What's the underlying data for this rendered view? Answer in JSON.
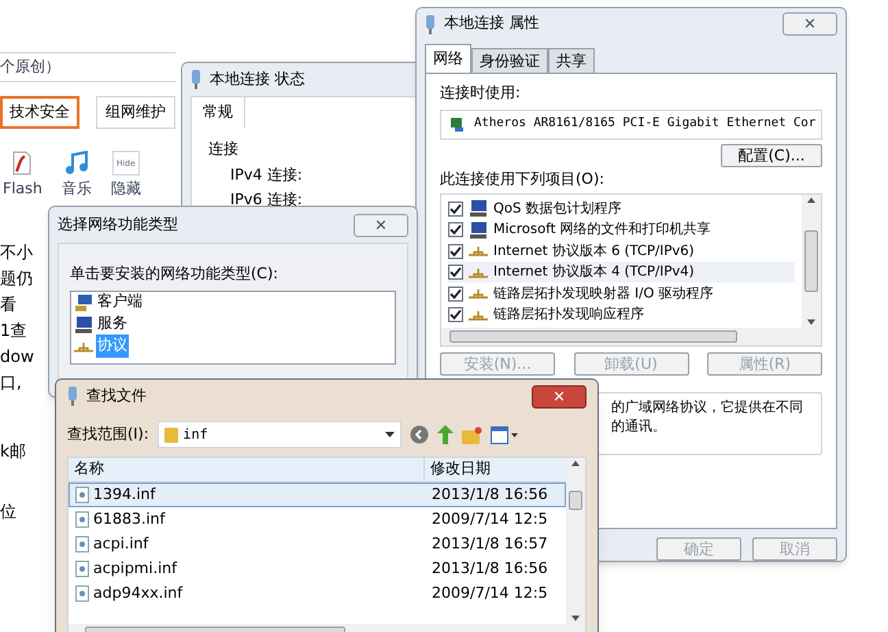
{
  "background_page": {
    "breadcrumb": "个原创）",
    "tabs": [
      {
        "label": "技术安全",
        "selected": true
      },
      {
        "label": "组网维护",
        "selected": false
      }
    ],
    "tools": [
      {
        "kind": "flash",
        "label": "Flash"
      },
      {
        "kind": "music",
        "label": "音乐"
      },
      {
        "kind": "hide",
        "label": "隐藏",
        "icon_text": "Hide"
      }
    ],
    "text_fragments": [
      "不小",
      "题仍",
      "看",
      "1查",
      "dow",
      "口,",
      "k邮",
      "位"
    ]
  },
  "status_window": {
    "title": "本地连接 状态",
    "tabs": [
      {
        "label": "常规",
        "selected": true
      }
    ],
    "section": "连接",
    "rows": [
      "IPv4 连接:",
      "IPv6 连接:"
    ]
  },
  "properties_window": {
    "title": "本地连接 属性",
    "close": "✕",
    "tabs": [
      {
        "label": "网络",
        "selected": true
      },
      {
        "label": "身份验证",
        "selected": false
      },
      {
        "label": "共享",
        "selected": false
      }
    ],
    "connect_using_label": "连接时使用:",
    "adapter": "Atheros AR8161/8165 PCI-E Gigabit Ethernet Cor",
    "configure_button": "配置(C)...",
    "items_label": "此连接使用下列项目(O):",
    "items": [
      {
        "kind": "service",
        "label": "QoS 数据包计划程序",
        "checked": true,
        "selected": false
      },
      {
        "kind": "service",
        "label": "Microsoft 网络的文件和打印机共享",
        "checked": true,
        "selected": false
      },
      {
        "kind": "protocol",
        "label": "Internet 协议版本 6 (TCP/IPv6)",
        "checked": true,
        "selected": false
      },
      {
        "kind": "protocol",
        "label": "Internet 协议版本 4 (TCP/IPv4)",
        "checked": true,
        "selected": true
      },
      {
        "kind": "protocol",
        "label": "链路层拓扑发现映射器 I/O 驱动程序",
        "checked": true,
        "selected": false
      },
      {
        "kind": "protocol",
        "label": "链路层拓扑发现响应程序",
        "checked": true,
        "selected": false
      }
    ],
    "action_buttons": [
      {
        "label": "安装(N)...",
        "disabled": true
      },
      {
        "label": "卸载(U)",
        "disabled": true
      },
      {
        "label": "属性(R)",
        "disabled": true
      }
    ],
    "description_lines": [
      "的广域网络协议，它提供在不同",
      "的通讯。"
    ],
    "footer_buttons": [
      {
        "label": "确定",
        "disabled": true
      },
      {
        "label": "取消",
        "disabled": true
      }
    ]
  },
  "select_window": {
    "title": "选择网络功能类型",
    "close": "✕",
    "prompt": "单击要安装的网络功能类型(C):",
    "types": [
      {
        "kind": "client",
        "label": "客户端",
        "selected": false
      },
      {
        "kind": "service",
        "label": "服务",
        "selected": false
      },
      {
        "kind": "protocol",
        "label": "协议",
        "selected": true
      }
    ]
  },
  "find_window": {
    "title": "查找文件",
    "close": "✕",
    "look_in_label": "查找范围(I):",
    "folder": "inf",
    "columns": [
      "名称",
      "修改日期"
    ],
    "files": [
      {
        "name": "1394.inf",
        "modified": "2013/1/8 16:56",
        "selected": true
      },
      {
        "name": "61883.inf",
        "modified": "2009/7/14 12:5",
        "selected": false
      },
      {
        "name": "acpi.inf",
        "modified": "2013/1/8 16:57",
        "selected": false
      },
      {
        "name": "acpipmi.inf",
        "modified": "2013/1/8 16:56",
        "selected": false
      },
      {
        "name": "adp94xx.inf",
        "modified": "2009/7/14 12:5",
        "selected": false
      }
    ]
  }
}
